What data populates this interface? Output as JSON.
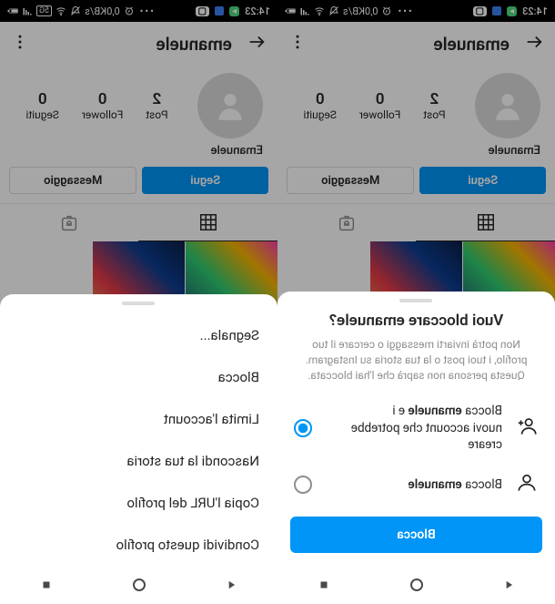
{
  "statusbar": {
    "time": "14:23",
    "net_speed": "0,0KB/s",
    "carrier_label": "5G"
  },
  "profile": {
    "username": "emanuele",
    "display_name": "Emanuele",
    "stats": {
      "posts_count": "2",
      "posts_label": "Post",
      "followers_count": "0",
      "followers_label": "Follower",
      "following_count": "0",
      "following_label": "Seguiti"
    },
    "follow_button": "Segui",
    "message_button": "Messaggio"
  },
  "menu_sheet": {
    "items": [
      "Segnala...",
      "Blocca",
      "Limita l'account",
      "Nascondi la tua storia",
      "Copia l'URL del profilo",
      "Condividi questo profilo"
    ]
  },
  "block_sheet": {
    "title": "Vuoi bloccare emanuele?",
    "description": "Non potrà inviarti messaggi o cercare il tuo profilo, i tuoi post o la tua storia su Instagram. Questa persona non saprà che l'hai bloccata.",
    "option1_prefix": "Blocca ",
    "option1_bold": "emanuele",
    "option1_mid": " e i",
    "option1_line2": "nuovi account che potrebbe creare",
    "option2_prefix": "Blocca ",
    "option2_bold": "emanuele",
    "button": "Blocca"
  },
  "colors": {
    "primary": "#0095f6",
    "text": "#262626",
    "muted": "#8e8e8e"
  }
}
